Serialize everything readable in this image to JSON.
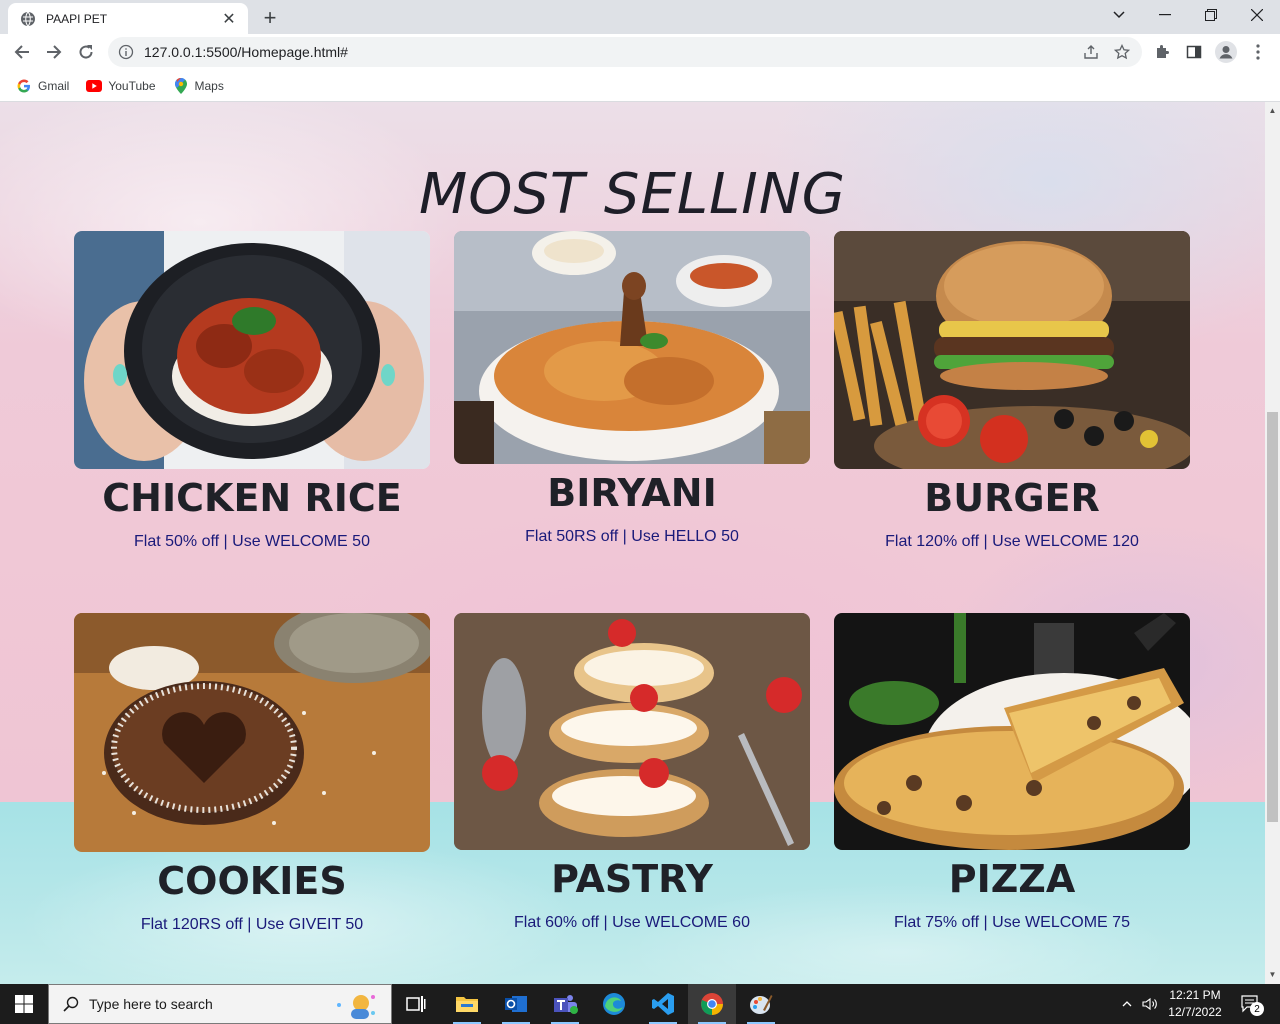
{
  "browser": {
    "tab_title": "PAAPI PET",
    "url": "127.0.0.1:5500/Homepage.html#",
    "bookmarks": [
      {
        "label": "Gmail",
        "icon": "google-icon"
      },
      {
        "label": "YouTube",
        "icon": "youtube-icon"
      },
      {
        "label": "Maps",
        "icon": "maps-icon"
      }
    ]
  },
  "page": {
    "section_title": "MOST SELLING",
    "items": [
      {
        "name": "CHICKEN RICE",
        "offer": "Flat 50% off | Use WELCOME 50",
        "image": "chicken-rice-photo"
      },
      {
        "name": "BIRYANI",
        "offer": "Flat 50RS off | Use HELLO 50",
        "image": "biryani-photo"
      },
      {
        "name": "BURGER",
        "offer": "Flat 120% off | Use WELCOME 120",
        "image": "burger-photo"
      },
      {
        "name": "COOKIES",
        "offer": "Flat 120RS off | Use GIVEIT 50",
        "image": "cookies-photo"
      },
      {
        "name": "PASTRY",
        "offer": "Flat 60% off | Use WELCOME 60",
        "image": "pastry-photo"
      },
      {
        "name": "PIZZA",
        "offer": "Flat 75% off | Use WELCOME 75",
        "image": "pizza-photo"
      }
    ]
  },
  "taskbar": {
    "search_placeholder": "Type here to search",
    "time": "12:21 PM",
    "date": "12/7/2022",
    "notification_count": "2"
  }
}
